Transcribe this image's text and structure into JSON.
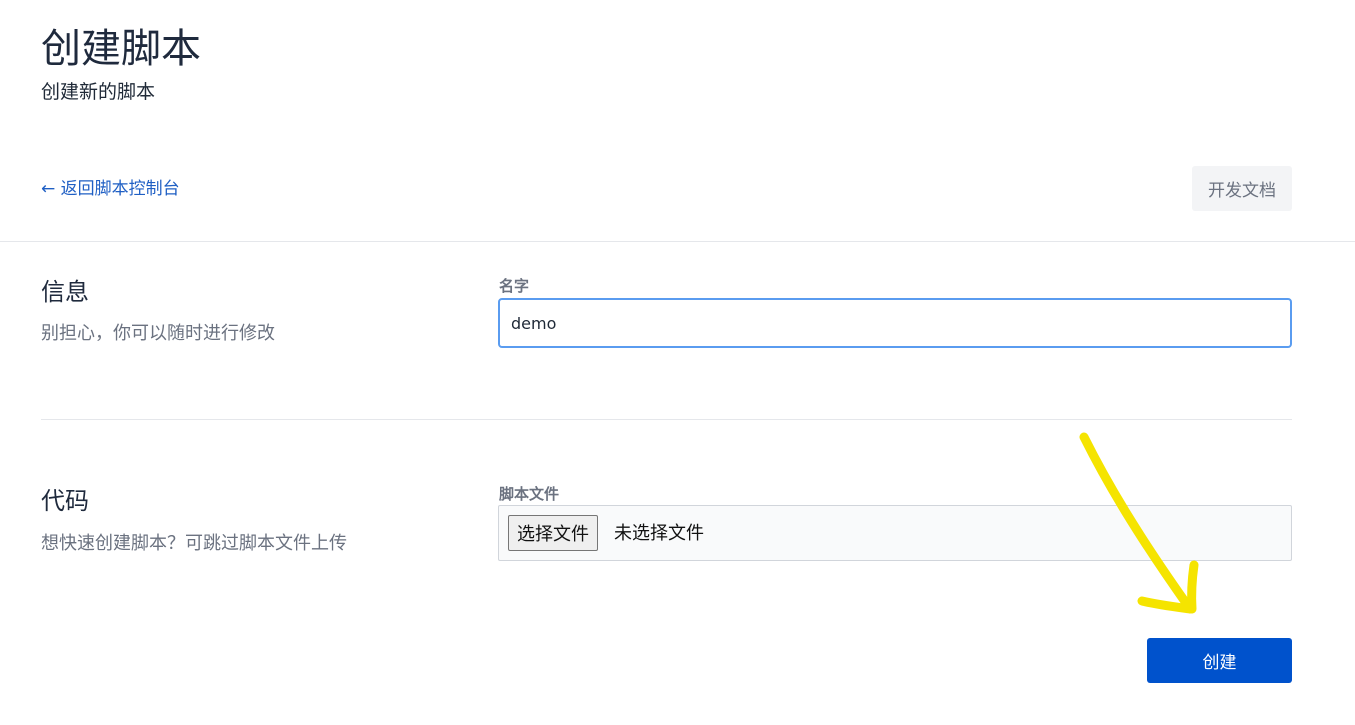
{
  "header": {
    "title": "创建脚本",
    "subtitle": "创建新的脚本"
  },
  "nav": {
    "back_label": "← 返回脚本控制台",
    "docs_label": "开发文档"
  },
  "sections": {
    "info": {
      "title": "信息",
      "description": "别担心，你可以随时进行修改",
      "name_label": "名字",
      "name_value": "demo"
    },
    "code": {
      "title": "代码",
      "description": "想快速创建脚本？可跳过脚本文件上传",
      "file_label": "脚本文件",
      "file_button_label": "选择文件",
      "file_status": "未选择文件"
    }
  },
  "actions": {
    "create_label": "创建"
  },
  "colors": {
    "primary": "#0052cc",
    "link": "#1f5fc4",
    "focus_border": "#5a9cf0",
    "annotation": "#f5e400"
  }
}
